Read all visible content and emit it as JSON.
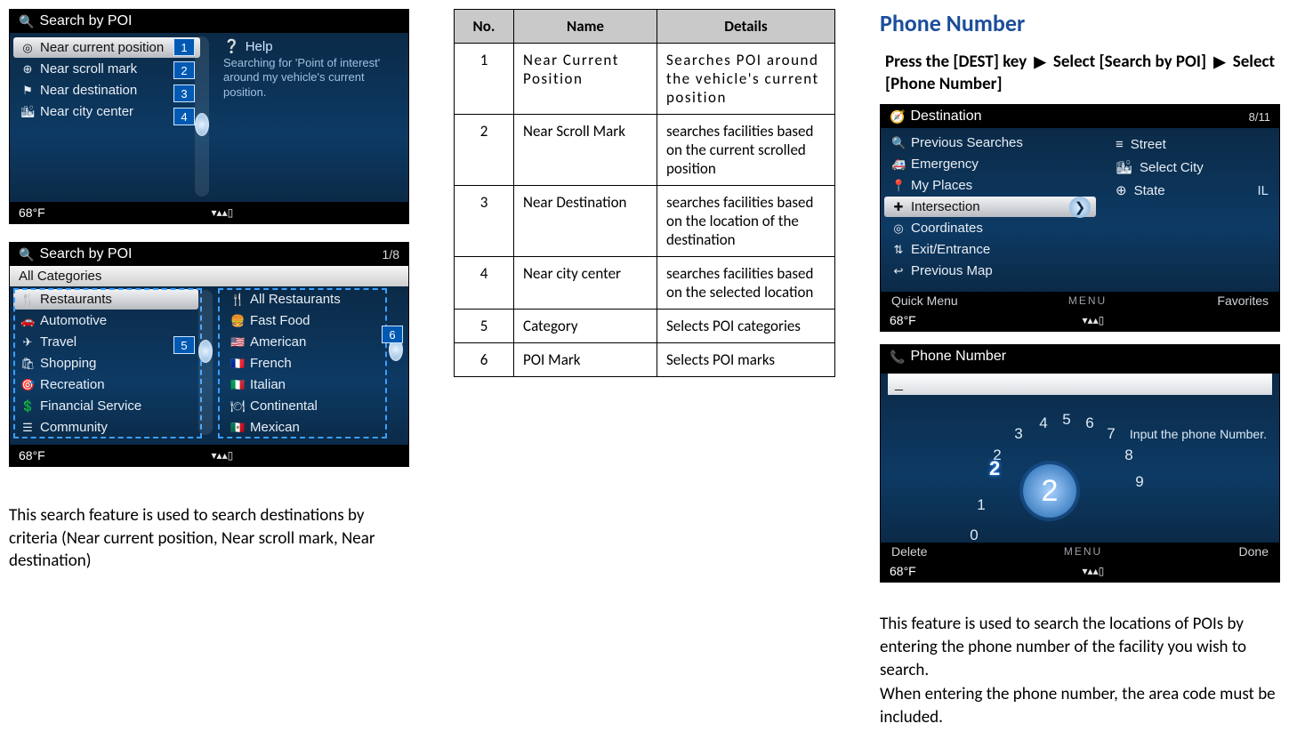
{
  "status": {
    "temp": "68°F",
    "signal": "▾▴▴▯"
  },
  "screen1": {
    "title": "Search by POI",
    "items": [
      {
        "icon": "◎",
        "label": "Near current position",
        "selected": true
      },
      {
        "icon": "⊕",
        "label": "Near scroll mark"
      },
      {
        "icon": "⚑",
        "label": "Near destination"
      },
      {
        "icon": "🏙",
        "label": "Near city center"
      }
    ],
    "help": {
      "title": "Help",
      "body": "Searching for 'Point of interest' around my vehicle's current position."
    },
    "callouts": [
      "1",
      "2",
      "3",
      "4"
    ]
  },
  "screen2": {
    "title": "Search by POI",
    "page": "1/8",
    "allcat": "All Categories",
    "colA": [
      {
        "icon": "🍴",
        "label": "Restaurants",
        "selected": true
      },
      {
        "icon": "🚗",
        "label": "Automotive"
      },
      {
        "icon": "✈",
        "label": "Travel"
      },
      {
        "icon": "🛍",
        "label": "Shopping"
      },
      {
        "icon": "🎯",
        "label": "Recreation"
      },
      {
        "icon": "💲",
        "label": "Financial Service"
      },
      {
        "icon": "☰",
        "label": "Community"
      }
    ],
    "colB": [
      {
        "icon": "🍴",
        "label": "All Restaurants"
      },
      {
        "icon": "🍔",
        "label": "Fast Food"
      },
      {
        "icon": "🇺🇸",
        "label": "American"
      },
      {
        "icon": "🇫🇷",
        "label": "French"
      },
      {
        "icon": "🇮🇹",
        "label": "Italian"
      },
      {
        "icon": "🍽",
        "label": "Continental"
      },
      {
        "icon": "🇲🇽",
        "label": "Mexican"
      }
    ],
    "callouts": {
      "five": "5",
      "six": "6"
    }
  },
  "leftParagraph": "This search feature is used to search destinations by criteria (Near current position, Near scroll mark, Near destination)",
  "table": {
    "headers": {
      "no": "No.",
      "name": "Name",
      "details": "Details"
    },
    "rows": [
      {
        "no": "1",
        "name": "Near Current Position",
        "details": "Searches POI around the vehicle's current position"
      },
      {
        "no": "2",
        "name": "Near Scroll Mark",
        "details": "searches facilities based on the current scrolled position"
      },
      {
        "no": "3",
        "name": "Near Destination",
        "details": "searches facilities based on the location of the destination"
      },
      {
        "no": "4",
        "name": "Near city center",
        "details": "searches facilities based on the selected location"
      },
      {
        "no": "5",
        "name": "Category",
        "details": "Selects POI categories"
      },
      {
        "no": "6",
        "name": "POI Mark",
        "details": "Selects POI marks"
      }
    ]
  },
  "right": {
    "heading": "Phone Number",
    "lead": {
      "a": "Press the [DEST] key",
      "b": "Select [Search by POI]",
      "c": "Select [Phone Number]"
    },
    "screenA": {
      "title": "Destination",
      "page": "8/11",
      "left": [
        {
          "icon": "🔍",
          "label": "Previous Searches"
        },
        {
          "icon": "🚑",
          "label": "Emergency"
        },
        {
          "icon": "📍",
          "label": "My Places"
        },
        {
          "icon": "✚",
          "label": "Intersection",
          "selected": true
        },
        {
          "icon": "◎",
          "label": "Coordinates"
        },
        {
          "icon": "⇅",
          "label": "Exit/Entrance"
        },
        {
          "icon": "↩",
          "label": "Previous Map"
        }
      ],
      "right": [
        {
          "icon": "≡",
          "label": "Street"
        },
        {
          "icon": "🏙",
          "label": "Select City"
        },
        {
          "icon": "⊕",
          "label": "State",
          "value": "IL"
        }
      ],
      "soft": {
        "l": "Quick Menu",
        "m": "MENU",
        "r": "Favorites"
      }
    },
    "screenB": {
      "title": "Phone Number",
      "entry": "_",
      "hint": "Input the phone Number.",
      "dial": {
        "picked": "2",
        "big": "2",
        "ring": [
          "1",
          "2",
          "3",
          "4",
          "5",
          "6",
          "7",
          "8",
          "9",
          "0"
        ]
      },
      "soft": {
        "l": "Delete",
        "m": "MENU",
        "r": "Done"
      }
    },
    "para1": "This feature is used to search the locations of POIs by entering the phone number of the facility you wish to search.",
    "para2": "When entering the phone number, the area code must be included."
  }
}
